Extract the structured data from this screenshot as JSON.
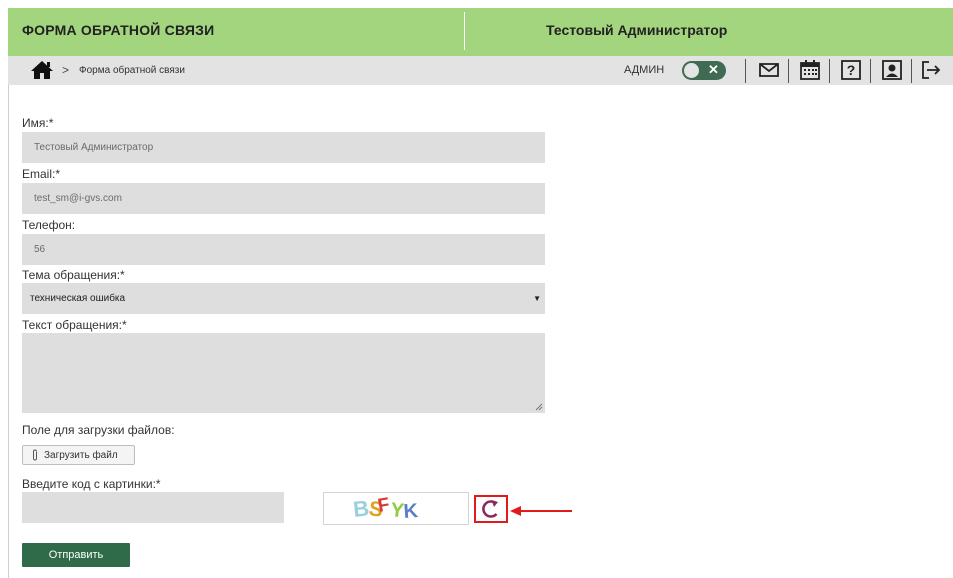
{
  "header": {
    "app_title": "ФОРМА ОБРАТНОЙ СВЯЗИ",
    "user_name": "Тестовый Администратор"
  },
  "navbar": {
    "breadcrumb_separator": ">",
    "breadcrumb_current": "Форма обратной связи",
    "role_label": "АДМИН",
    "role_toggle_mark": "✕",
    "icons": [
      "home-icon",
      "mail-icon",
      "calendar-icon",
      "help-icon",
      "profile-icon",
      "logout-icon"
    ]
  },
  "form": {
    "name_label": "Имя:*",
    "name_value": "Тестовый Администратор",
    "email_label": "Email:*",
    "email_value": "test_sm@i-gvs.com",
    "phone_label": "Телефон:",
    "phone_value": "56",
    "topic_label": "Тема обращения:*",
    "topic_value": "техническая ошибка",
    "topic_arrow": "▼",
    "text_label": "Текст обращения:*",
    "text_value": "",
    "upload_label": "Поле для загрузки файлов:",
    "upload_button": "Загрузить файл",
    "captcha_label": "Введите код с картинки:*",
    "captcha_value": "",
    "captcha_code": "BSFYK",
    "submit_button": "Отправить"
  },
  "colors": {
    "header_bg": "#a3d47e",
    "nav_bg": "#e3e3e3",
    "field_bg": "#dedede",
    "button_green": "#2f6b48",
    "highlight_red": "#e01b1b"
  }
}
